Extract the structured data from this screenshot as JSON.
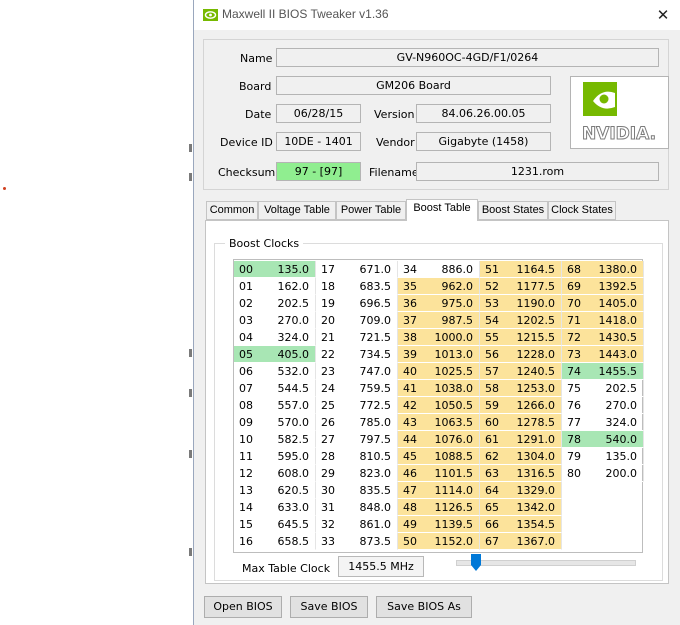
{
  "window": {
    "title": "Maxwell II BIOS Tweaker v1.36",
    "close_glyph": "✕"
  },
  "info": {
    "name_label": "Name",
    "name_value": "GV-N960OC-4GD/F1/0264",
    "board_label": "Board",
    "board_value": "GM206 Board",
    "date_label": "Date",
    "date_value": "06/28/15",
    "version_label": "Version",
    "version_value": "84.06.26.00.05",
    "device_label": "Device ID",
    "device_value": "10DE - 1401",
    "vendor_label": "Vendor",
    "vendor_value": "Gigabyte (1458)",
    "checksum_label": "Checksum",
    "checksum_value": "97 - [97]",
    "filename_label": "Filename",
    "filename_value": "1231.rom",
    "logo_text": "NVIDIA."
  },
  "tabs": [
    "Common",
    "Voltage Table",
    "Power Table",
    "Boost Table",
    "Boost States",
    "Clock States"
  ],
  "active_tab": "Boost Table",
  "boost": {
    "group_label": "Boost Clocks",
    "columns": [
      [
        [
          "00",
          "135.0",
          "g"
        ],
        [
          "01",
          "162.0",
          ""
        ],
        [
          "02",
          "202.5",
          ""
        ],
        [
          "03",
          "270.0",
          ""
        ],
        [
          "04",
          "324.0",
          ""
        ],
        [
          "05",
          "405.0",
          "g"
        ],
        [
          "06",
          "532.0",
          ""
        ],
        [
          "07",
          "544.5",
          ""
        ],
        [
          "08",
          "557.0",
          ""
        ],
        [
          "09",
          "570.0",
          ""
        ],
        [
          "10",
          "582.5",
          ""
        ],
        [
          "11",
          "595.0",
          ""
        ],
        [
          "12",
          "608.0",
          ""
        ],
        [
          "13",
          "620.5",
          ""
        ],
        [
          "14",
          "633.0",
          ""
        ],
        [
          "15",
          "645.5",
          ""
        ],
        [
          "16",
          "658.5",
          ""
        ]
      ],
      [
        [
          "17",
          "671.0",
          ""
        ],
        [
          "18",
          "683.5",
          ""
        ],
        [
          "19",
          "696.5",
          ""
        ],
        [
          "20",
          "709.0",
          ""
        ],
        [
          "21",
          "721.5",
          ""
        ],
        [
          "22",
          "734.5",
          ""
        ],
        [
          "23",
          "747.0",
          ""
        ],
        [
          "24",
          "759.5",
          ""
        ],
        [
          "25",
          "772.5",
          ""
        ],
        [
          "26",
          "785.0",
          ""
        ],
        [
          "27",
          "797.5",
          ""
        ],
        [
          "28",
          "810.5",
          ""
        ],
        [
          "29",
          "823.0",
          ""
        ],
        [
          "30",
          "835.5",
          ""
        ],
        [
          "31",
          "848.0",
          ""
        ],
        [
          "32",
          "861.0",
          ""
        ],
        [
          "33",
          "873.5",
          ""
        ]
      ],
      [
        [
          "34",
          "886.0",
          ""
        ],
        [
          "35",
          "962.0",
          "y"
        ],
        [
          "36",
          "975.0",
          "y"
        ],
        [
          "37",
          "987.5",
          "y"
        ],
        [
          "38",
          "1000.0",
          "y"
        ],
        [
          "39",
          "1013.0",
          "y"
        ],
        [
          "40",
          "1025.5",
          "y"
        ],
        [
          "41",
          "1038.0",
          "y"
        ],
        [
          "42",
          "1050.5",
          "y"
        ],
        [
          "43",
          "1063.5",
          "y"
        ],
        [
          "44",
          "1076.0",
          "y"
        ],
        [
          "45",
          "1088.5",
          "y"
        ],
        [
          "46",
          "1101.5",
          "y"
        ],
        [
          "47",
          "1114.0",
          "y"
        ],
        [
          "48",
          "1126.5",
          "y"
        ],
        [
          "49",
          "1139.5",
          "y"
        ],
        [
          "50",
          "1152.0",
          "y"
        ]
      ],
      [
        [
          "51",
          "1164.5",
          "y"
        ],
        [
          "52",
          "1177.5",
          "y"
        ],
        [
          "53",
          "1190.0",
          "y"
        ],
        [
          "54",
          "1202.5",
          "y"
        ],
        [
          "55",
          "1215.5",
          "y"
        ],
        [
          "56",
          "1228.0",
          "y"
        ],
        [
          "57",
          "1240.5",
          "y"
        ],
        [
          "58",
          "1253.0",
          "y"
        ],
        [
          "59",
          "1266.0",
          "y"
        ],
        [
          "60",
          "1278.5",
          "y"
        ],
        [
          "61",
          "1291.0",
          "y"
        ],
        [
          "62",
          "1304.0",
          "y"
        ],
        [
          "63",
          "1316.5",
          "y"
        ],
        [
          "64",
          "1329.0",
          "y"
        ],
        [
          "65",
          "1342.0",
          "y"
        ],
        [
          "66",
          "1354.5",
          "y"
        ],
        [
          "67",
          "1367.0",
          "y"
        ]
      ],
      [
        [
          "68",
          "1380.0",
          "y"
        ],
        [
          "69",
          "1392.5",
          "y"
        ],
        [
          "70",
          "1405.0",
          "y"
        ],
        [
          "71",
          "1418.0",
          "y"
        ],
        [
          "72",
          "1430.5",
          "y"
        ],
        [
          "73",
          "1443.0",
          "y"
        ],
        [
          "74",
          "1455.5",
          "g"
        ],
        [
          "75",
          "202.5",
          ""
        ],
        [
          "76",
          "270.0",
          ""
        ],
        [
          "77",
          "324.0",
          ""
        ],
        [
          "78",
          "540.0",
          "g"
        ],
        [
          "79",
          "135.0",
          ""
        ],
        [
          "80",
          "200.0",
          ""
        ]
      ]
    ],
    "max_table_clock_label": "Max Table Clock",
    "max_table_clock_value": "1455.5 MHz",
    "slider_position": 0.1
  },
  "buttons": {
    "open": "Open BIOS",
    "save": "Save BIOS",
    "save_as": "Save BIOS As"
  },
  "colors": {
    "yellow": "#fce39b",
    "green": "#a8e6b4",
    "nvidia_green": "#76b900"
  }
}
